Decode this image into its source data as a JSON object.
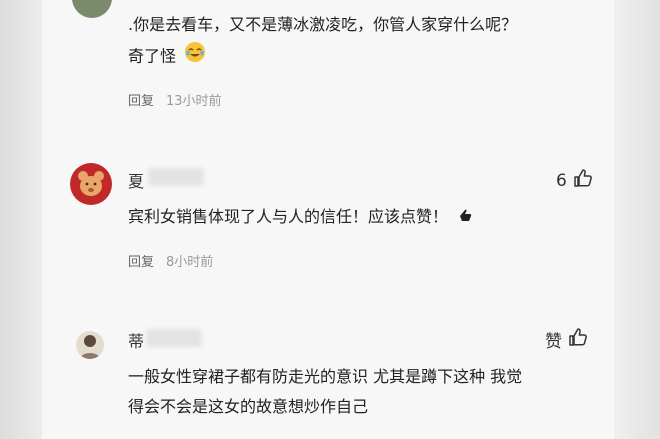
{
  "comments": [
    {
      "text_line1": ".你是去看车，又不是薄冰激凌吃，你管人家穿什么呢？",
      "text_line2": "奇了怪",
      "emoji": "cry-laugh-emoji",
      "reply_label": "回复",
      "time": "13小时前"
    },
    {
      "author": "夏",
      "like_count": "6",
      "text": "宾利女销售体现了人与人的信任！应该点赞！",
      "reply_label": "回复",
      "time": "8小时前"
    },
    {
      "author": "蒂",
      "like_label": "赞",
      "text_line1": "一般女性穿裙子都有防走光的意识 尤其是蹲下这种 我觉",
      "text_line2": "得会不会是这女的故意想炒作自己"
    }
  ]
}
